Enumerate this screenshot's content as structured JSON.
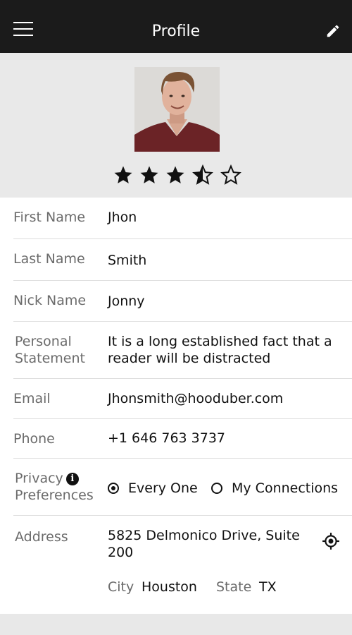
{
  "header": {
    "title": "Profile"
  },
  "profile": {
    "rating": 3.5,
    "rating_max": 5
  },
  "fields": {
    "first_name": {
      "label": "First Name",
      "value": "Jhon"
    },
    "last_name": {
      "label": "Last Name",
      "value": "Smith"
    },
    "nick_name": {
      "label": "Nick Name",
      "value": "Jonny"
    },
    "statement": {
      "label_line1": "Personal",
      "label_line2": "Statement",
      "value_line1": "It is a long established fact that a",
      "value_line2": "reader will be distracted"
    },
    "email": {
      "label": "Email",
      "value": "Jhonsmith@hooduber.com"
    },
    "phone": {
      "label": "Phone",
      "value": "+1 646 763 3737"
    },
    "privacy": {
      "label_line1": "Privacy",
      "label_line2": "Preferences",
      "options": [
        "Every One",
        "My Connections"
      ],
      "selected": "Every One"
    },
    "address": {
      "label": "Address",
      "value_line1": "5825 Delmonico Drive, Suite",
      "value_line2": "200",
      "city_label": "City",
      "city": "Houston",
      "state_label": "State",
      "state": "TX"
    }
  },
  "icons": {
    "menu": "hamburger-menu-icon",
    "edit": "pencil-icon",
    "info": "info-icon",
    "locate": "crosshair-location-icon"
  }
}
